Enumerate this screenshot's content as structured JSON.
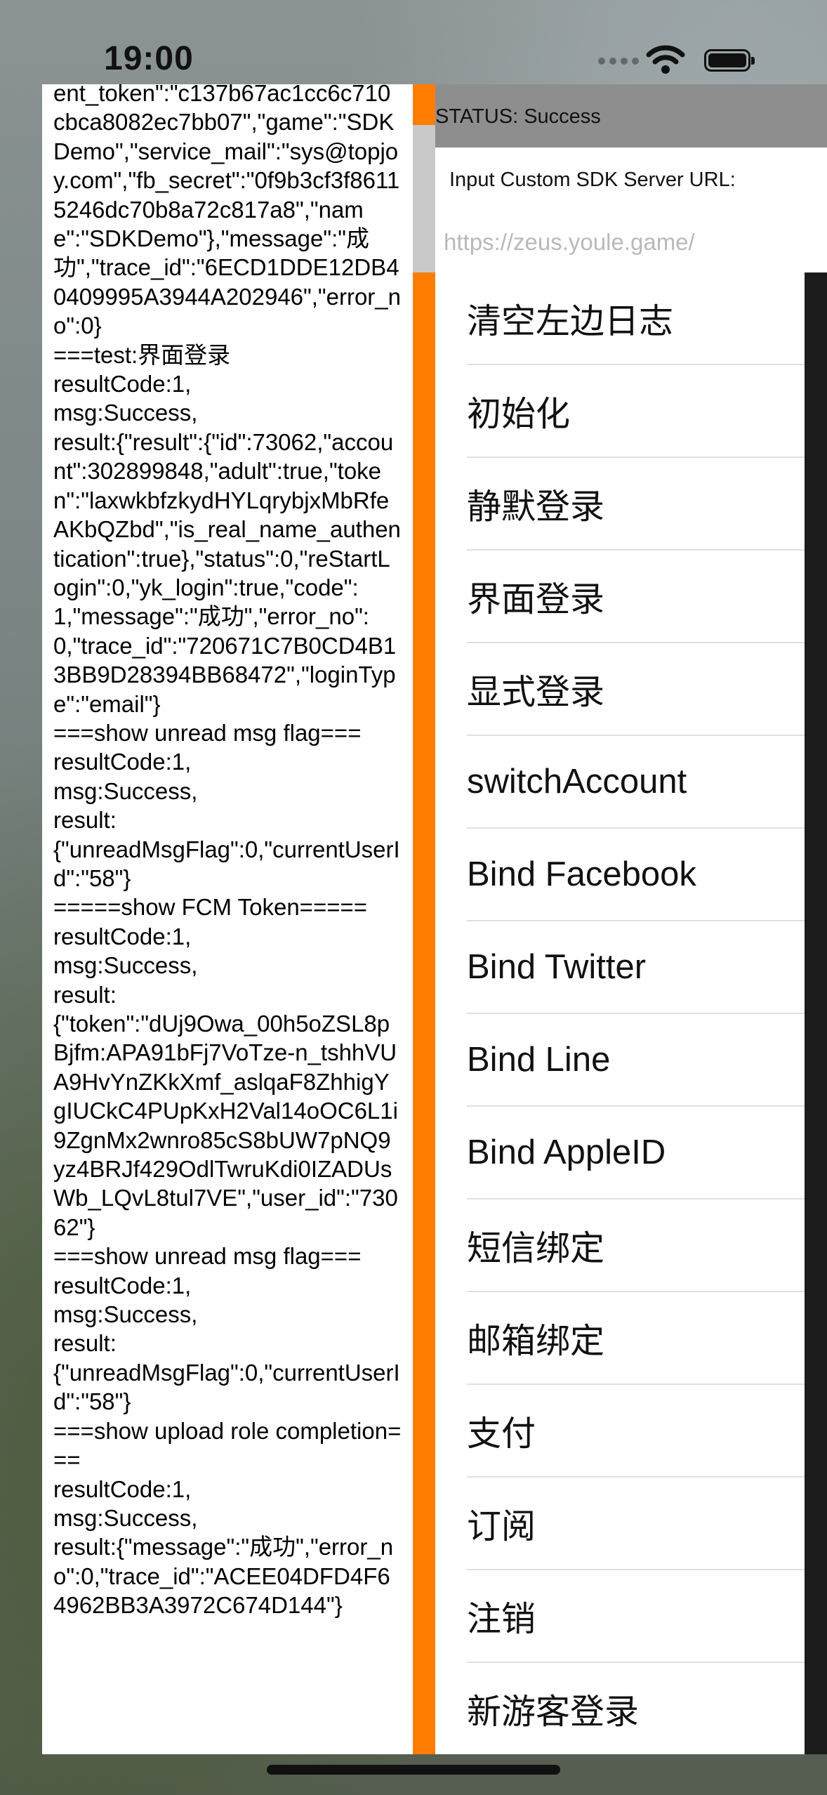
{
  "status_bar": {
    "time": "19:00"
  },
  "status": {
    "text": "STATUS: Success"
  },
  "server_url": {
    "label": "Input Custom SDK Server URL:",
    "placeholder": "https://zeus.youle.game/"
  },
  "log": {
    "text": "ent_token\":\"c137b67ac1cc6c710cbca8082ec7bb07\",\"game\":\"SDKDemo\",\"service_mail\":\"sys@topjoy.com\",\"fb_secret\":\"0f9b3cf3f86115246dc70b8a72c817a8\",\"name\":\"SDKDemo\"},\"message\":\"成功\",\"trace_id\":\"6ECD1DDE12DB40409995A3944A202946\",\"error_no\":0}\n===test:界面登录\nresultCode:1,\nmsg:Success,\nresult:{\"result\":{\"id\":73062,\"account\":302899848,\"adult\":true,\"token\":\"laxwkbfzkydHYLqrybjxMbRfeAKbQZbd\",\"is_real_name_authentication\":true},\"status\":0,\"reStartLogin\":0,\"yk_login\":true,\"code\":1,\"message\":\"成功\",\"error_no\":0,\"trace_id\":\"720671C7B0CD4B13BB9D28394BB68472\",\"loginType\":\"email\"}\n===show unread msg flag===\nresultCode:1,\nmsg:Success,\nresult:\n{\"unreadMsgFlag\":0,\"currentUserId\":\"58\"}\n=====show FCM Token=====\nresultCode:1,\nmsg:Success,\nresult:\n{\"token\":\"dUj9Owa_00h5oZSL8pBjfm:APA91bFj7VoTze-n_tshhVUA9HvYnZKkXmf_aslqaF8ZhhigYgIUCkC4PUpKxH2Val14oOC6L1i9ZgnMx2wnro85cS8bUW7pNQ9yz4BRJf429OdlTwruKdi0IZADUsWb_LQvL8tul7VE\",\"user_id\":\"73062\"}\n===show unread msg flag===\nresultCode:1,\nmsg:Success,\nresult:\n{\"unreadMsgFlag\":0,\"currentUserId\":\"58\"}\n===show upload role completion===\nresultCode:1,\nmsg:Success,\nresult:{\"message\":\"成功\",\"error_no\":0,\"trace_id\":\"ACEE04DFD4F64962BB3A3972C674D144\"}"
  },
  "menu": {
    "items": [
      "清空左边日志",
      "初始化",
      "静默登录",
      "界面登录",
      "显式登录",
      "switchAccount",
      "Bind Facebook",
      "Bind Twitter",
      "Bind Line",
      "Bind AppleID",
      "短信绑定",
      "邮箱绑定",
      "支付",
      "订阅",
      "注销",
      "新游客登录"
    ]
  },
  "colors": {
    "scroll_track": "#ff7d00",
    "status_bar_bg": "#8e8e8e",
    "panel_bg": "#ffffff"
  }
}
